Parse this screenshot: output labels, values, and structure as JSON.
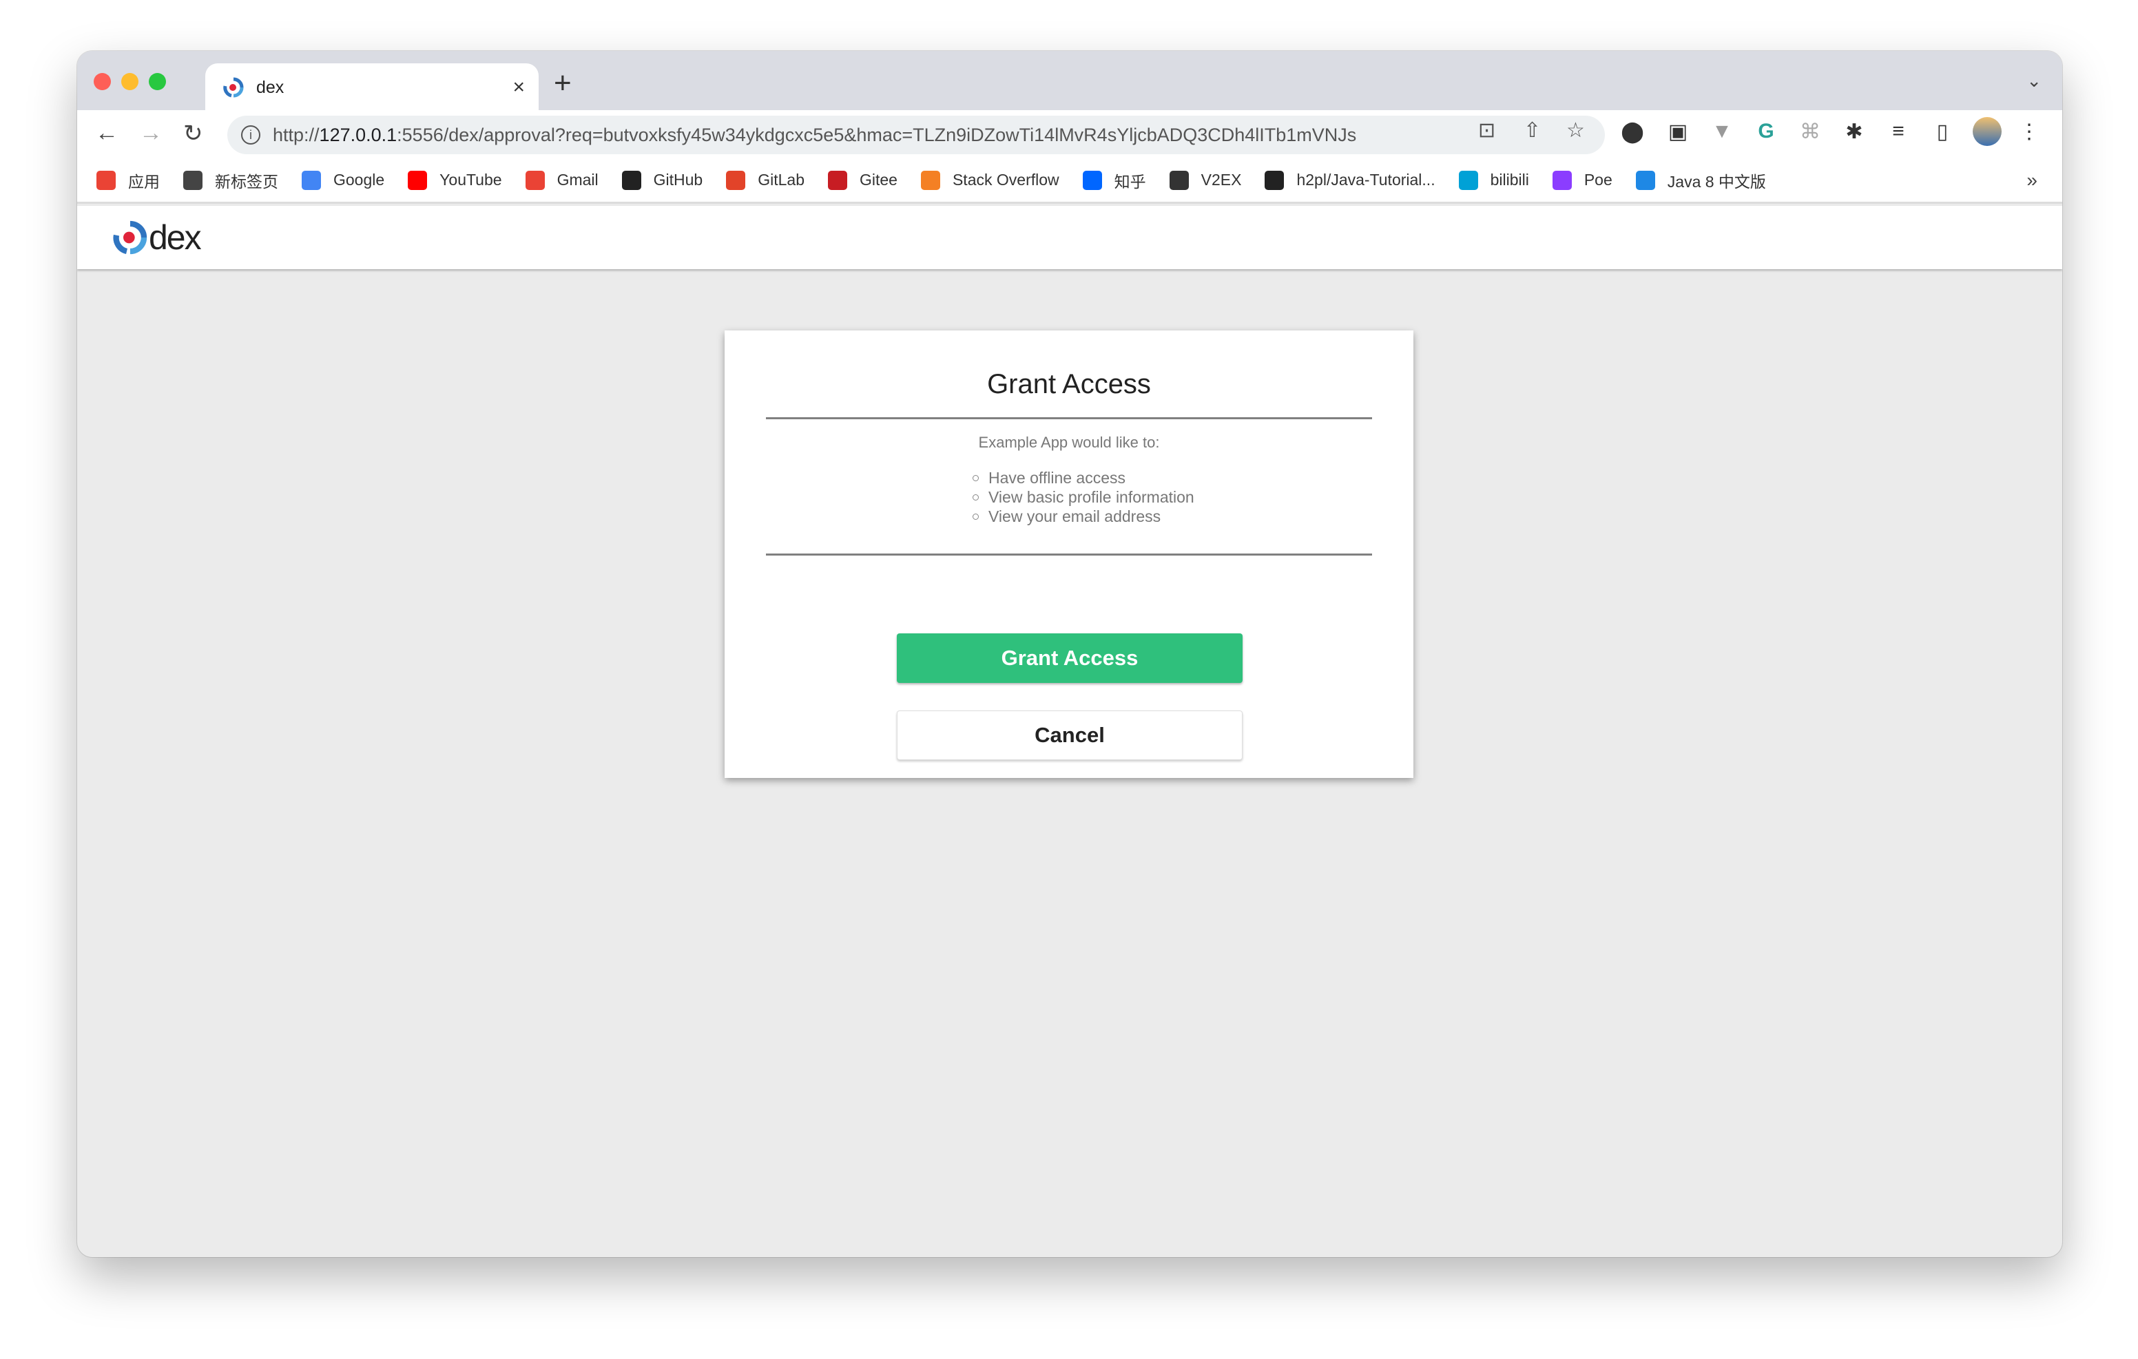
{
  "browser": {
    "tab": {
      "title": "dex",
      "close_label": "×"
    },
    "new_tab_label": "+",
    "tab_menu_label": "⌄",
    "url_prefix": "http://",
    "url_host": "127.0.0.1",
    "url_rest": ":5556/dex/approval?req=butvoxksfy45w34ykdgcxc5e5&hmac=TLZn9iDZowTi14lMvR4sYljcbADQ3CDh4lITb1mVNJs",
    "bookmarks": [
      {
        "label": "应用",
        "icon": "apps-grid-icon",
        "color": "#ea4335"
      },
      {
        "label": "新标签页",
        "icon": "globe-icon",
        "color": "#444444"
      },
      {
        "label": "Google",
        "icon": "google-icon",
        "color": "#4285f4"
      },
      {
        "label": "YouTube",
        "icon": "youtube-icon",
        "color": "#ff0000"
      },
      {
        "label": "Gmail",
        "icon": "gmail-icon",
        "color": "#ea4335"
      },
      {
        "label": "GitHub",
        "icon": "github-icon",
        "color": "#222222"
      },
      {
        "label": "GitLab",
        "icon": "gitlab-icon",
        "color": "#e24329"
      },
      {
        "label": "Gitee",
        "icon": "gitee-icon",
        "color": "#c71d23"
      },
      {
        "label": "Stack Overflow",
        "icon": "stackoverflow-icon",
        "color": "#f48024"
      },
      {
        "label": "知乎",
        "icon": "zhihu-icon",
        "color": "#0066ff"
      },
      {
        "label": "V2EX",
        "icon": "v2ex-icon",
        "color": "#333333"
      },
      {
        "label": "h2pl/Java-Tutorial...",
        "icon": "github-icon",
        "color": "#222222"
      },
      {
        "label": "bilibili",
        "icon": "bilibili-icon",
        "color": "#00a1d6"
      },
      {
        "label": "Poe",
        "icon": "poe-icon",
        "color": "#8b3dff"
      },
      {
        "label": "Java 8 中文版",
        "icon": "java-icon",
        "color": "#1e88e5"
      }
    ],
    "bookmarks_more": "»"
  },
  "header": {
    "logo_text": "dex"
  },
  "approval": {
    "title": "Grant Access",
    "subtitle": "Example App would like to:",
    "scopes": [
      "Have offline access",
      "View basic profile information",
      "View your email address"
    ],
    "grant_label": "Grant Access",
    "cancel_label": "Cancel",
    "accent_color": "#2fc07c"
  }
}
